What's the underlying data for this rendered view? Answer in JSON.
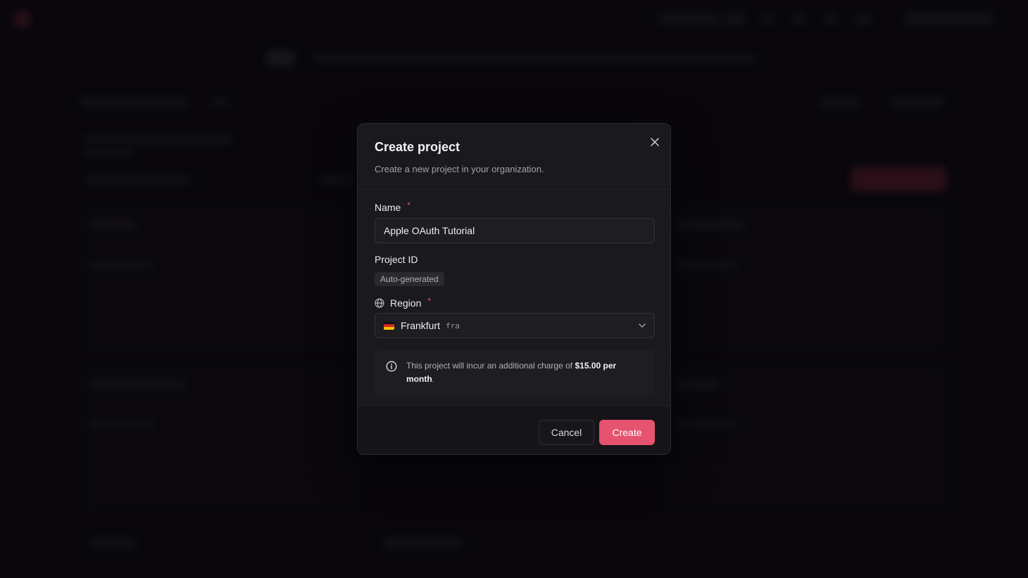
{
  "modal": {
    "title": "Create project",
    "subtitle": "Create a new project in your organization.",
    "close_icon": "close-icon"
  },
  "form": {
    "name": {
      "label": "Name",
      "required_marker": "*",
      "value": "Apple OAuth Tutorial"
    },
    "project_id": {
      "label": "Project ID",
      "badge": "Auto-generated"
    },
    "region": {
      "label": "Region",
      "required_marker": "*",
      "icon": "globe-icon",
      "selected_name": "Frankfurt",
      "selected_code": "fra",
      "flag_icon": "germany-flag-icon"
    },
    "notice": {
      "icon": "info-icon",
      "text_before": "This project will incur an additional charge of ",
      "amount": "$15.00 per month",
      "text_after": "."
    }
  },
  "footer": {
    "cancel_label": "Cancel",
    "create_label": "Create"
  },
  "colors": {
    "accent": "#e5536f",
    "modal_bg": "#1a191e",
    "backdrop": "#0b0a0e"
  }
}
